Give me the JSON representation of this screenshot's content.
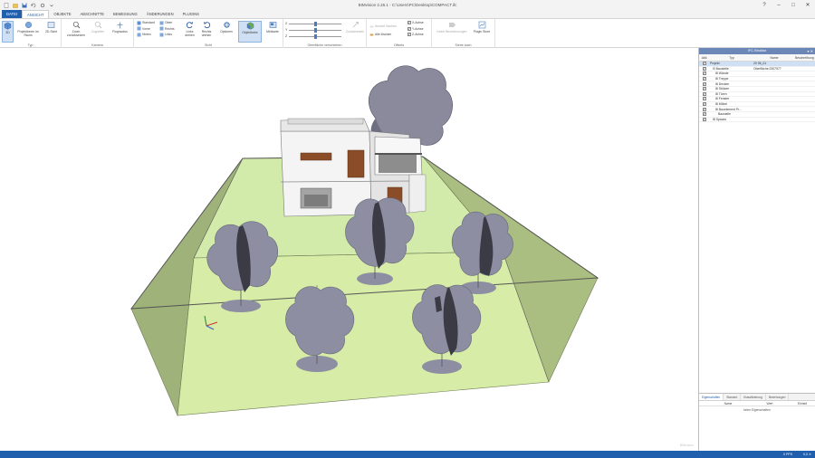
{
  "window": {
    "title": "BIMvision 2.26.1 - C:\\Users\\PC\\Desktop\\COMPACT.ifc",
    "help_glyph": "?",
    "minimize_glyph": "–",
    "maximize_glyph": "□",
    "close_glyph": "✕"
  },
  "tabs": [
    {
      "label": "DATEI"
    },
    {
      "label": "ANSICHT"
    },
    {
      "label": "OBJEKTE"
    },
    {
      "label": "ABSCHNITTE"
    },
    {
      "label": "BEMESSUNG"
    },
    {
      "label": "ÄNDERUNGEN"
    },
    {
      "label": "PLUGINS"
    }
  ],
  "ribbon": {
    "typ": {
      "label": "Typ",
      "btn_3d": "3D",
      "btn_projektionen": "Projektionen im Raum",
      "btn_2d": "2D-Sicht"
    },
    "kamera": {
      "label": "Kamera",
      "btn_zoom": "Zoom zurücksetzen",
      "btn_zugreifen": "Zugreifen",
      "btn_flugmodus": "Flugmodus"
    },
    "sicht": {
      "label": "Sicht",
      "views": [
        "Standard",
        "Oben",
        "Vorne",
        "Rechts",
        "Hinten",
        "Links"
      ],
      "btn_links_drehen": "Links drehen",
      "btn_rechts_drehen": "Rechts drehen",
      "btn_optionen": "Optionen",
      "btn_objektfarbe": "Objektfarbe",
      "btn_minikarte": "Minikarte"
    },
    "oberflaeche": {
      "label": "Oberfläche verschieben",
      "axes": [
        "X",
        "Y",
        "Z"
      ],
      "slider_levels": [
        0.5,
        0.5,
        0.5
      ],
      "btn_zuruecksetzen": "Zurücksetzen"
    },
    "offsets": {
      "label": "Offsets",
      "btn_ansicht_loeschen": "Ansicht löschen",
      "btn_alle_loeschen": "Alle löschen",
      "btn_x_achse": "X-Achse",
      "btn_y_achse": "Y-Achse",
      "btn_z_achse": "Z-Achse"
    },
    "siehe_auch": {
      "label": "Siehe auch",
      "btn_bezeichnungen": "Keine Bezeichnungen",
      "btn_plugin_store": "Plugin Store"
    }
  },
  "tree": {
    "title": "IFC-Struktur",
    "columns": {
      "check": "Akti.",
      "typ": "Typ",
      "name": "Name",
      "rest": "Beschreibung"
    },
    "rows": [
      {
        "typ": "Projekt",
        "name": "20 06_01",
        "selected": true
      },
      {
        "typ": "⊟ Baustelle",
        "name": "Oberfläche:2307577"
      },
      {
        "typ": "⊞ Wände",
        "name": ""
      },
      {
        "typ": "⊞ Treppe",
        "name": ""
      },
      {
        "typ": "⊞ Decken",
        "name": ""
      },
      {
        "typ": "⊞ Stützen",
        "name": ""
      },
      {
        "typ": "⊞ Türen",
        "name": ""
      },
      {
        "typ": "⊞ Fenster",
        "name": ""
      },
      {
        "typ": "⊞ Möbel",
        "name": ""
      },
      {
        "typ": "⊞ Bauelement Pr...",
        "name": ""
      },
      {
        "typ": "Baustelle",
        "name": ""
      },
      {
        "typ": "⊞ Spaces",
        "name": ""
      }
    ]
  },
  "props": {
    "tabs": [
      "Eigenschaften",
      "Standort",
      "Klassifizierung",
      "Beziehungen"
    ],
    "columns": [
      "Name",
      "Wert",
      "Einheit"
    ],
    "empty_text": "keine Eigenschaften"
  },
  "status": {
    "fps": "0 FPS",
    "coords": "0,0 ✕"
  },
  "viewport": {
    "watermark": "BIMvision"
  },
  "colors": {
    "accent": "#1f5fae",
    "ground": "#d6eba6",
    "tree": "#8e8ea3",
    "tree_shadow": "#3b3b45"
  }
}
